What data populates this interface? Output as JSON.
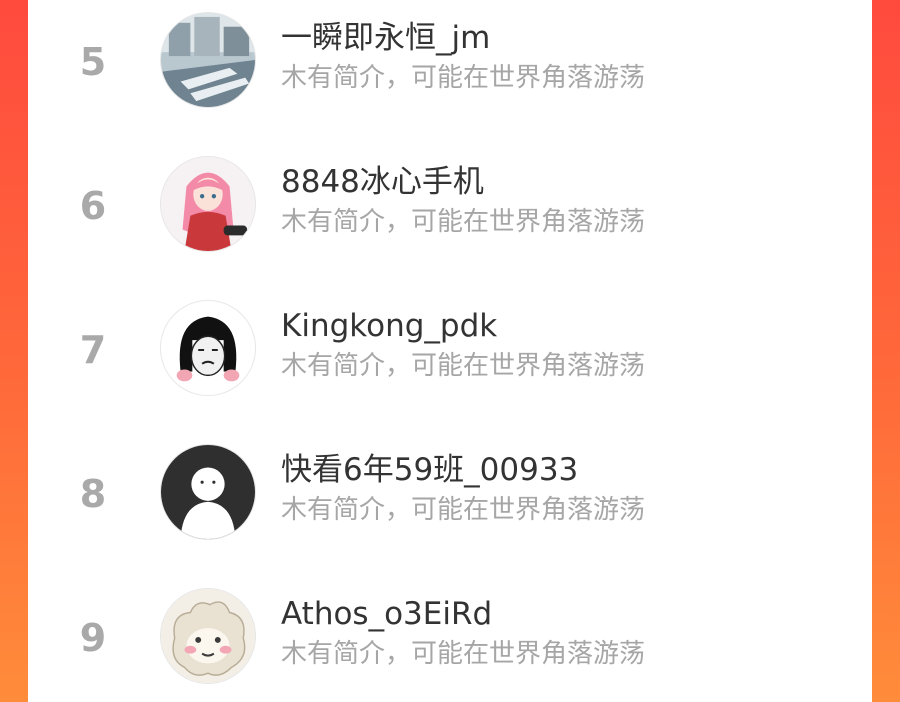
{
  "colors": {
    "background_top": "#ff4a3e",
    "background_bottom": "#ff8c3a",
    "card": "#ffffff",
    "rank": "#a9a9a9",
    "name": "#333333",
    "bio": "#a6a6a6"
  },
  "ranking": {
    "items": [
      {
        "rank": "5",
        "name": "一瞬即永恒_jm",
        "bio": "木有简介，可能在世界角落游荡",
        "avatar": "street-scene-avatar"
      },
      {
        "rank": "6",
        "name": "8848冰心手机",
        "bio": "木有简介，可能在世界角落游荡",
        "avatar": "anime-girl-pink-hair-avatar"
      },
      {
        "rank": "7",
        "name": "Kingkong_pdk",
        "bio": "木有简介，可能在世界角落游荡",
        "avatar": "meme-face-avatar"
      },
      {
        "rank": "8",
        "name": "快看6年59班_00933",
        "bio": "木有简介，可能在世界角落游荡",
        "avatar": "default-user-avatar"
      },
      {
        "rank": "9",
        "name": "Athos_o3EiRd",
        "bio": "木有简介，可能在世界角落游荡",
        "avatar": "fluffy-monster-avatar"
      }
    ]
  }
}
